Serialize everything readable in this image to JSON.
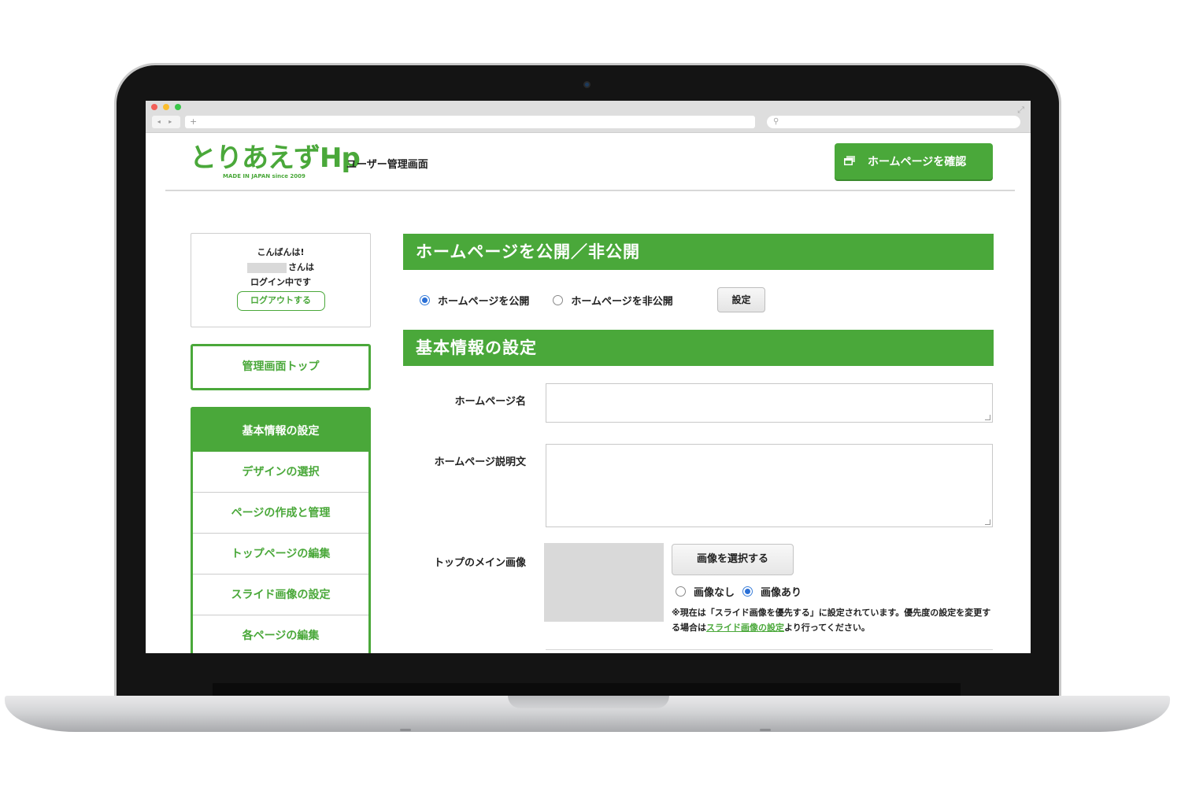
{
  "header": {
    "logo_text": "とりあえずHp",
    "logo_tagline": "MADE IN JAPAN since 2009",
    "subtitle": "ユーザー管理画面",
    "view_site_button": "ホームページを確認"
  },
  "greeting": {
    "line1": "こんばんは!",
    "line2_suffix": "さんは",
    "line3": "ログイン中です",
    "logout_button": "ログアウトする"
  },
  "sidebar": {
    "top_button": "管理画面トップ",
    "items": [
      {
        "label": "基本情報の設定",
        "active": true
      },
      {
        "label": "デザインの選択"
      },
      {
        "label": "ページの作成と管理"
      },
      {
        "label": "トップページの編集"
      },
      {
        "label": "スライド画像の設定"
      },
      {
        "label": "各ページの編集"
      }
    ]
  },
  "publish": {
    "title": "ホームページを公開／非公開",
    "option_public": "ホームページを公開",
    "option_private": "ホームページを非公開",
    "selected": "public",
    "set_button": "設定"
  },
  "basic_info": {
    "title": "基本情報の設定",
    "site_name_label": "ホームページ名",
    "site_name_value": "",
    "description_label": "ホームページ説明文",
    "description_value": "",
    "main_image_label": "トップのメイン画像",
    "select_image_button": "画像を選択する",
    "option_no_image": "画像なし",
    "option_with_image": "画像あり",
    "image_selected": "with_image",
    "note_before_link": "※現在は「スライド画像を優先する」に設定されています。優先度の設定を変更する場合は",
    "note_link": "スライド画像の設定",
    "note_after_link": "より行ってください。"
  },
  "browser": {
    "new_tab": "+",
    "back_forward": "◂ ▸"
  },
  "colors": {
    "brand_green": "#4aa83a",
    "radio_blue": "#2a6fd6"
  }
}
